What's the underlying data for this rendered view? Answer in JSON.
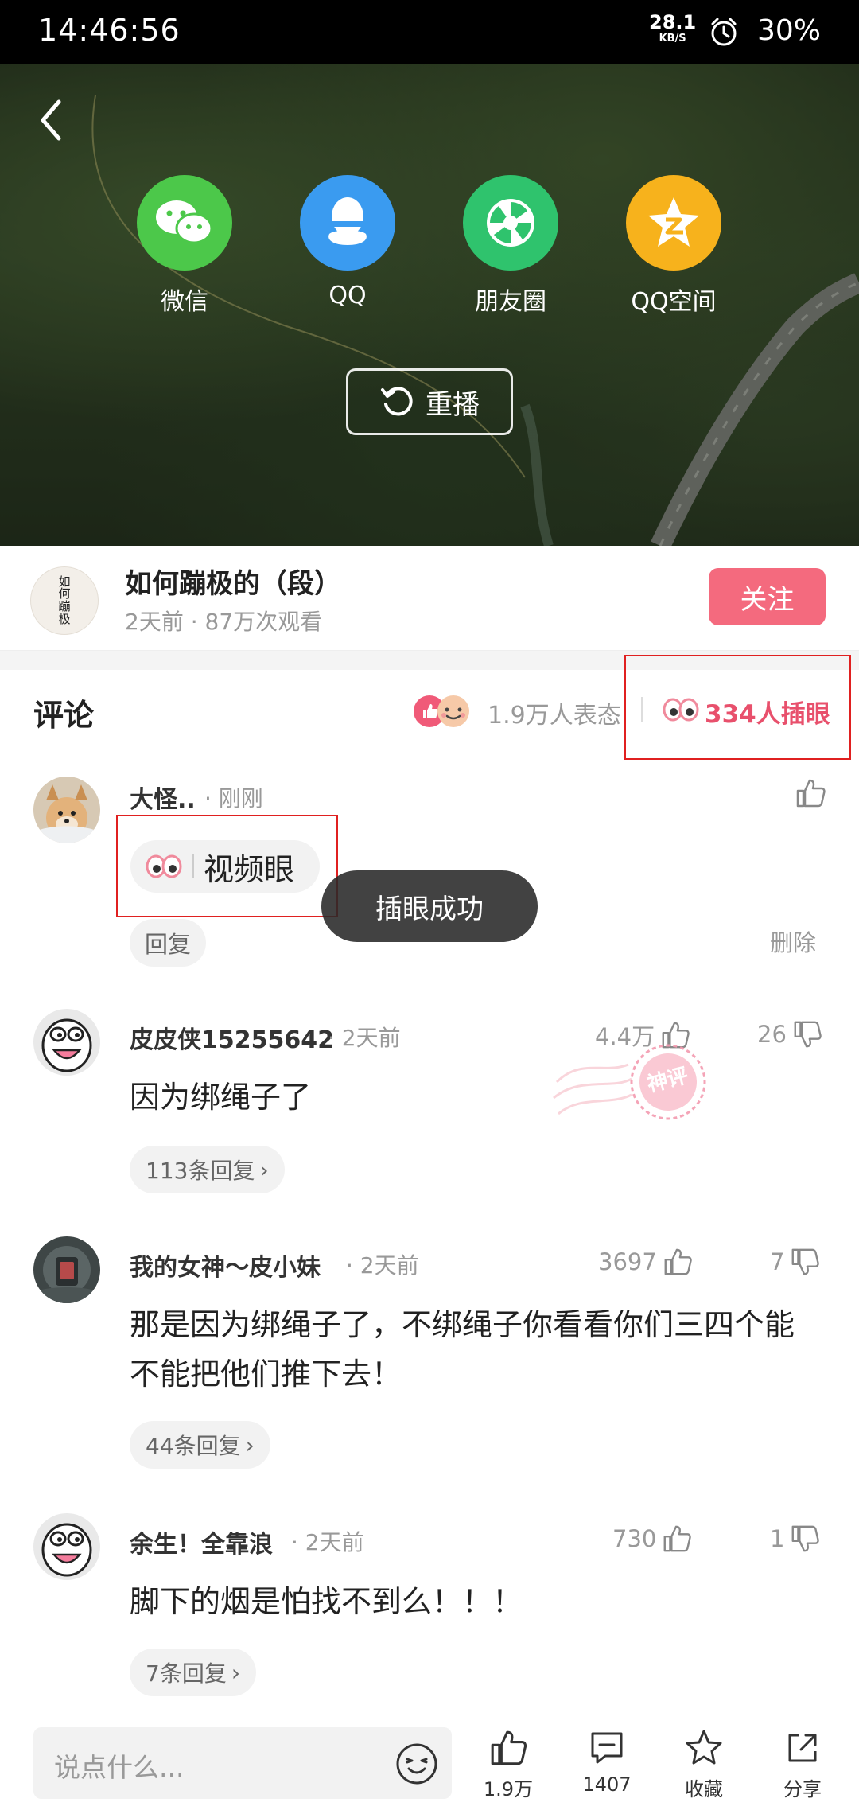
{
  "status_bar": {
    "time": "14:46:56",
    "net_speed": "28.1",
    "net_unit": "KB/S",
    "battery": "30%"
  },
  "video": {
    "share_options": [
      {
        "label": "微信",
        "icon": "wechat-icon",
        "color": "#4cc84a"
      },
      {
        "label": "QQ",
        "icon": "qq-icon",
        "color": "#3a9bf0"
      },
      {
        "label": "朋友圈",
        "icon": "moments-icon",
        "color": "#2fc36d"
      },
      {
        "label": "QQ空间",
        "icon": "qzone-icon",
        "color": "#f7b21c"
      }
    ],
    "replay_label": "重播"
  },
  "author": {
    "avatar_text": "如\n何\n蹦\n极",
    "name": "如何蹦极的（段）",
    "meta": "2天前 · 87万次观看",
    "follow_label": "关注"
  },
  "comments_header": {
    "title": "评论",
    "reaction_count": "1.9万人表态",
    "insert_count": "334人插眼"
  },
  "comments": [
    {
      "user": "大怪..",
      "time": "· 刚刚",
      "tag": "视频眼",
      "reply_label": "回复",
      "delete_label": "删除"
    },
    {
      "user": "皮皮侠15255642",
      "time": "· 2天前",
      "likes": "4.4万",
      "dislikes": "26",
      "text": "因为绑绳子了",
      "replies": "113条回复"
    },
    {
      "user": "我的女神～皮小妹",
      "time": "· 2天前",
      "likes": "3697",
      "dislikes": "7",
      "text": "那是因为绑绳子了，不绑绳子你看看你们三四个能不能把他们推下去！",
      "replies": "44条回复"
    },
    {
      "user": "余生！全靠浪",
      "time": "· 2天前",
      "likes": "730",
      "dislikes": "1",
      "text": "脚下的烟是怕找不到么！！！",
      "replies": "7条回复"
    }
  ],
  "toast": "插眼成功",
  "stamp_text": "神评",
  "bottom_bar": {
    "placeholder": "说点什么...",
    "like_count": "1.9万",
    "comment_count": "1407",
    "favorite_label": "收藏",
    "share_label": "分享"
  },
  "colors": {
    "accent": "#e8506c",
    "follow": "#f46a7e",
    "highlight_box": "#e02020"
  }
}
